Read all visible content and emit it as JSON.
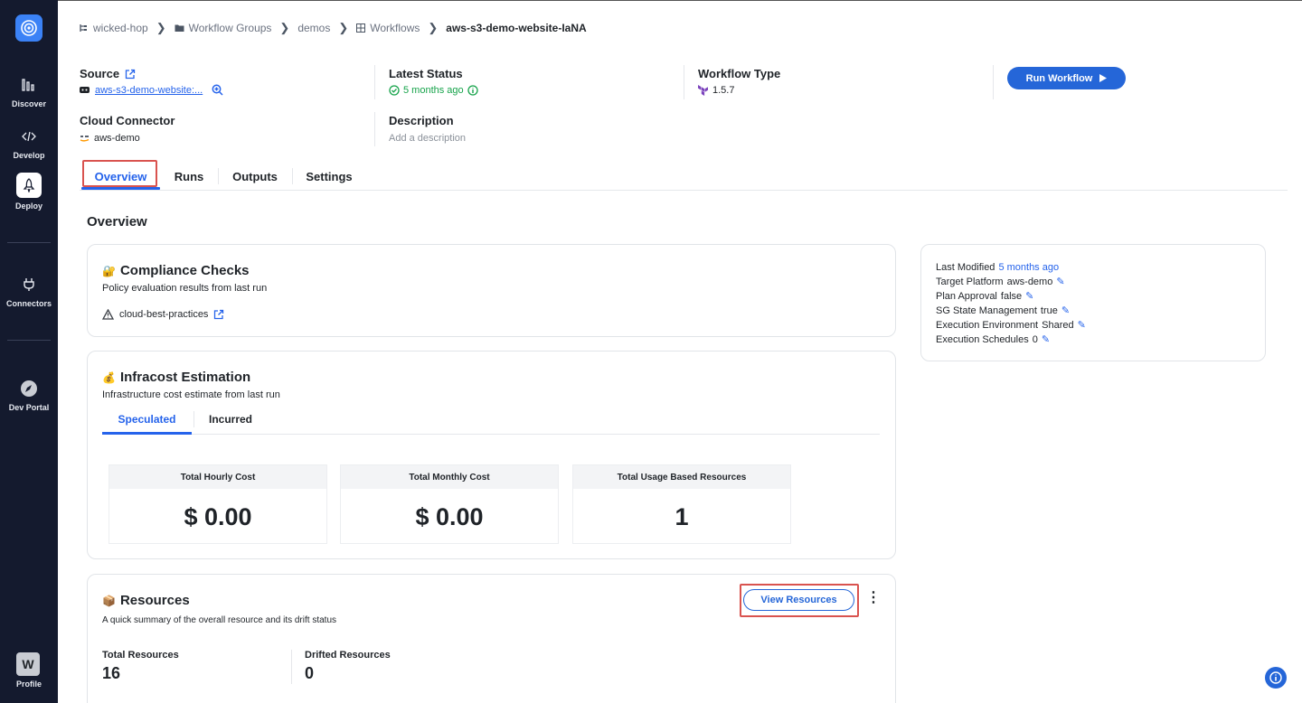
{
  "sidebar": {
    "items": [
      {
        "label": "Discover",
        "icon": "bar-chart-icon"
      },
      {
        "label": "Develop",
        "icon": "code-icon"
      },
      {
        "label": "Deploy",
        "icon": "rocket-icon"
      },
      {
        "label": "Connectors",
        "icon": "plug-icon"
      },
      {
        "label": "Dev Portal",
        "icon": "portal-icon"
      }
    ],
    "profile": {
      "initial": "W",
      "label": "Profile"
    }
  },
  "breadcrumb": {
    "org": "wicked-hop",
    "groups": "Workflow Groups",
    "group": "demos",
    "workflows": "Workflows",
    "current": "aws-s3-demo-website-IaNA"
  },
  "header": {
    "source_label": "Source",
    "source_value": "aws-s3-demo-website:...",
    "status_label": "Latest Status",
    "status_value": "5 months ago",
    "type_label": "Workflow Type",
    "type_value": "1.5.7",
    "connector_label": "Cloud Connector",
    "connector_value": "aws-demo",
    "description_label": "Description",
    "description_placeholder": "Add a description",
    "run_button": "Run Workflow"
  },
  "tabs": [
    "Overview",
    "Runs",
    "Outputs",
    "Settings"
  ],
  "overview_title": "Overview",
  "compliance": {
    "title": "Compliance Checks",
    "subtitle": "Policy evaluation results from last run",
    "policy": "cloud-best-practices"
  },
  "meta": {
    "last_modified_label": "Last Modified",
    "last_modified_value": "5 months ago",
    "target_platform_label": "Target Platform",
    "target_platform_value": "aws-demo",
    "plan_approval_label": "Plan Approval",
    "plan_approval_value": "false",
    "sg_state_label": "SG State Management",
    "sg_state_value": "true",
    "exec_env_label": "Execution Environment",
    "exec_env_value": "Shared",
    "exec_sched_label": "Execution Schedules",
    "exec_sched_value": "0"
  },
  "infracost": {
    "title": "Infracost Estimation",
    "subtitle": "Infrastructure cost estimate from last run",
    "tabs": [
      "Speculated",
      "Incurred"
    ],
    "boxes": [
      {
        "label": "Total Hourly Cost",
        "value": "$ 0.00"
      },
      {
        "label": "Total Monthly Cost",
        "value": "$ 0.00"
      },
      {
        "label": "Total Usage Based Resources",
        "value": "1"
      }
    ]
  },
  "resources": {
    "title": "Resources",
    "subtitle": "A quick summary of the overall resource and its drift status",
    "view_button": "View Resources",
    "total_label": "Total Resources",
    "total_value": "16",
    "drifted_label": "Drifted Resources",
    "drifted_value": "0"
  },
  "colors": {
    "sidebar": "#141a2e",
    "accent": "#2563eb",
    "success": "#16a34a",
    "highlight": "#d9534f"
  }
}
